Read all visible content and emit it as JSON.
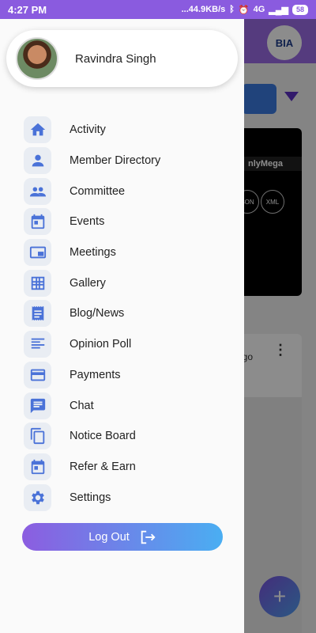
{
  "status_bar": {
    "time": "4:27 PM",
    "speed": "...44.9KB/s",
    "network": "4G",
    "battery": "58"
  },
  "background": {
    "logo_text": "BIA",
    "card_title": "nlyMega",
    "card_badges": [
      "SON",
      "XML"
    ],
    "post_time": "ago"
  },
  "drawer": {
    "user_name": "Ravindra Singh",
    "menu": [
      {
        "label": "Activity",
        "icon": "home-icon"
      },
      {
        "label": "Member Directory",
        "icon": "person-icon"
      },
      {
        "label": "Committee",
        "icon": "group-icon"
      },
      {
        "label": "Events",
        "icon": "calendar-icon"
      },
      {
        "label": "Meetings",
        "icon": "meeting-icon"
      },
      {
        "label": "Gallery",
        "icon": "grid-icon"
      },
      {
        "label": "Blog/News",
        "icon": "receipt-icon"
      },
      {
        "label": "Opinion Poll",
        "icon": "poll-lines-icon"
      },
      {
        "label": "Payments",
        "icon": "card-icon"
      },
      {
        "label": "Chat",
        "icon": "chat-icon"
      },
      {
        "label": "Notice Board",
        "icon": "copy-icon"
      },
      {
        "label": "Refer & Earn",
        "icon": "calendar-icon"
      },
      {
        "label": "Settings",
        "icon": "gear-icon"
      }
    ],
    "logout_label": "Log Out"
  },
  "colors": {
    "accent_purple": "#8c5de0",
    "accent_blue": "#4aaef2",
    "icon_blue": "#4a72d8",
    "icon_bg": "#e9edf3"
  }
}
